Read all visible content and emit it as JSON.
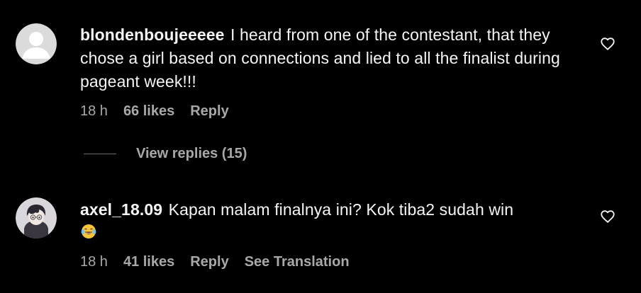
{
  "comments": [
    {
      "username": "blondenboujeeeee",
      "text": "I heard from one of the contestant, that they chose a girl based on connections and lied to all the finalist during pageant week!!!",
      "time": "18 h",
      "likes": "66 likes",
      "reply_label": "Reply",
      "avatar_icon": "default-avatar-icon",
      "like_icon": "heart-outline-icon"
    },
    {
      "username": "axel_18.09",
      "text": "Kapan malam finalnya ini? Kok tiba2 sudah win",
      "emoji": "😂",
      "time": "18 h",
      "likes": "41 likes",
      "reply_label": "Reply",
      "translate_label": "See Translation",
      "avatar_icon": "anime-avatar-icon",
      "like_icon": "heart-outline-icon"
    }
  ],
  "view_replies_label": "View replies (15)",
  "colors": {
    "background": "#000000",
    "primary_text": "#f5f5f5",
    "secondary_text": "#a8a8a8"
  }
}
